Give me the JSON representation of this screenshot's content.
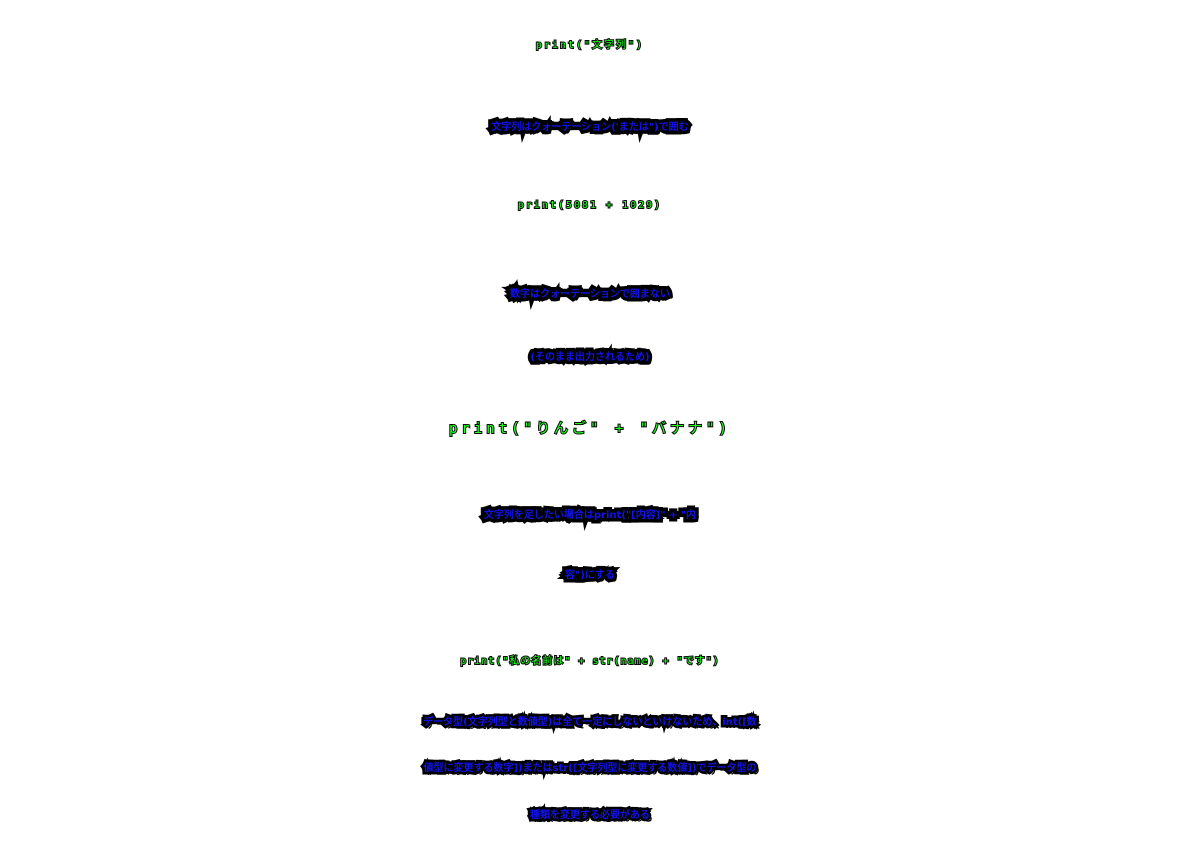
{
  "code_lines": {
    "line1": "print(\"文字列\")",
    "line2": "print(5081 + 1029)",
    "line3": "print(\"りんご\" + \"バナナ\")",
    "line4": "print(\"私の名前は\" + str(name) + \"です\")"
  },
  "notes": {
    "note1": "文字列はクォーテーション('または\")で囲む",
    "note2_line1": "数字はクォーテーションで囲まない",
    "note2_line2": "(そのまま出力されるため)",
    "note3_line1": "文字列を足したい場合はprint(\"[内容]\" + \"内",
    "note3_line2": "容\")にする",
    "note4_line1": "データ型(文字列型と数値型)は全て一定にしないといけないため、int([数",
    "note4_line2": "値型に変更する数字])またはstr([文字列型に変更する数値])でデータ型の",
    "note4_line3": "種類を変更する必要がある"
  },
  "colors": {
    "code_text": "#22ff22",
    "note_text": "#1212e6",
    "outline": "#000000",
    "background": "#ffffff"
  }
}
